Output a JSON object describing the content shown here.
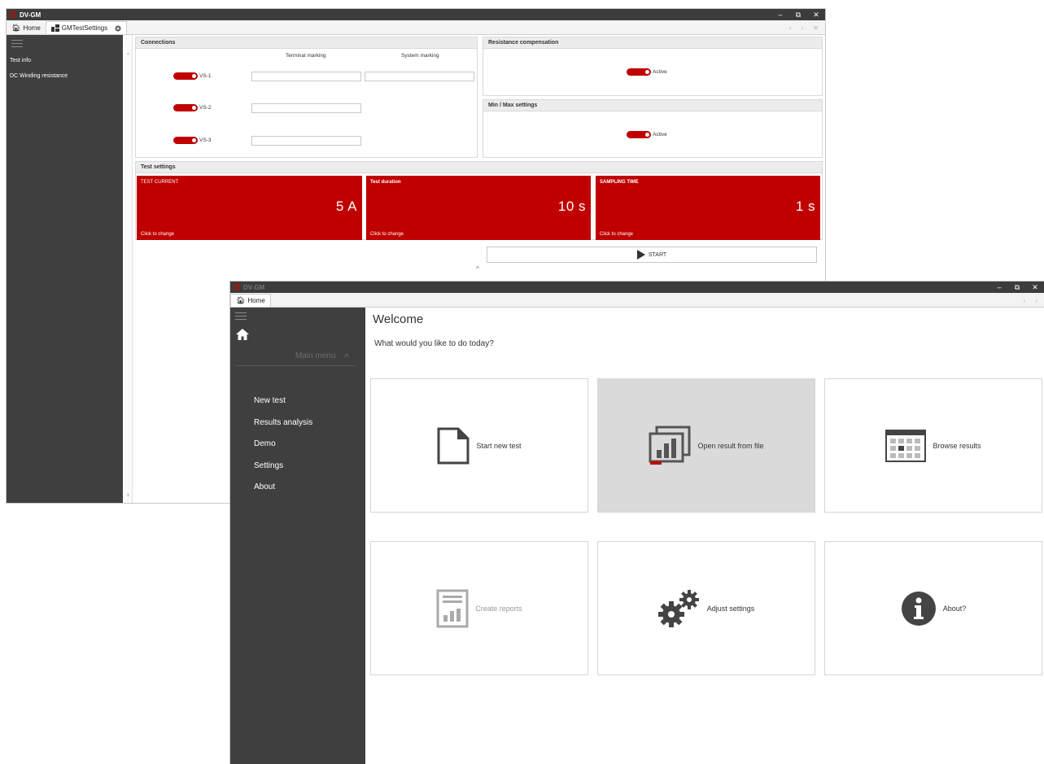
{
  "back_window": {
    "title": "DV-GM",
    "window_controls": [
      "–",
      "⧉",
      "✕"
    ],
    "tabs": [
      {
        "label": "Home",
        "icon": "home-icon"
      },
      {
        "label": "GMTestSettings",
        "icon": "settings-grid-icon",
        "closable": true
      }
    ],
    "sidebar_items": [
      "Test info",
      "DC Winding resistance"
    ],
    "connections": {
      "header": "Connections",
      "col_terminal": "Terminal marking",
      "col_system": "System marking",
      "rows": [
        {
          "label": "VS-1",
          "active": true,
          "terminal": "",
          "system": ""
        },
        {
          "label": "VS-2",
          "active": true,
          "terminal": ""
        },
        {
          "label": "VS-3",
          "active": true,
          "terminal": ""
        }
      ]
    },
    "resistance_compensation": {
      "header": "Resistance compensation",
      "toggle_label": "Active",
      "active": true
    },
    "min_max": {
      "header": "Min / Max settings",
      "toggle_label": "Active",
      "active": true
    },
    "test_settings": {
      "header": "Test settings",
      "tiles": [
        {
          "title": "TEST CURRENT",
          "value": "5 A",
          "hint": "Click to change"
        },
        {
          "title": "Test duration",
          "value": "10 s",
          "hint": "Click to change"
        },
        {
          "title": "SAMPLING TIME",
          "value": "1 s",
          "hint": "Click to change"
        }
      ]
    },
    "start_label": "START",
    "collapse_glyph": "^",
    "accent": "#c00000"
  },
  "front_window": {
    "title": "DV-GM",
    "window_controls": [
      "–",
      "⧉",
      "✕"
    ],
    "tabs": [
      {
        "label": "Home",
        "icon": "home-icon"
      }
    ],
    "menu_header": "Main menu",
    "menu_items": [
      "New test",
      "Results analysis",
      "Demo",
      "Settings",
      "About"
    ],
    "welcome": "Welcome",
    "question": "What would you like to do today?",
    "cards": [
      {
        "label": "Start new test",
        "icon": "new-file-icon"
      },
      {
        "label": "Open result from file",
        "icon": "open-chart-icon",
        "highlighted": true
      },
      {
        "label": "Browse results",
        "icon": "calendar-grid-icon"
      },
      {
        "label": "Create reports",
        "icon": "report-icon",
        "disabled": true
      },
      {
        "label": "Adjust settings",
        "icon": "gears-icon"
      },
      {
        "label": "About?",
        "icon": "info-icon"
      }
    ]
  }
}
